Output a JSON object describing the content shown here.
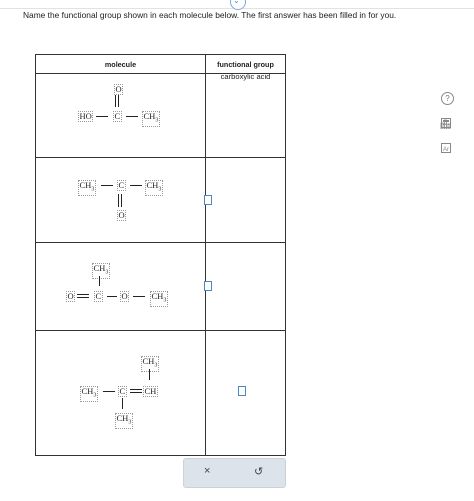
{
  "instructions": "Name the functional group shown in each molecule below. The first answer has been filled in for you.",
  "table": {
    "headers": {
      "molecule": "molecule",
      "functional_group": "functional group"
    },
    "rows": [
      {
        "answer": "carboxylic acid"
      },
      {
        "answer": ""
      },
      {
        "answer": ""
      },
      {
        "answer": ""
      }
    ]
  },
  "molecule1": {
    "o_top": "O",
    "ho": "HO",
    "c": "C",
    "ch3": "CH",
    "sub": "3"
  },
  "molecule2": {
    "ch3_left": "CH",
    "sub_left": "3",
    "c": "C",
    "ch3_right": "CH",
    "sub_right": "3",
    "o_bottom": "O"
  },
  "molecule3": {
    "ch3_top": "CH",
    "sub_top": "3",
    "o_left": "O",
    "c": "C",
    "o_mid": "O",
    "ch3_right": "CH",
    "sub_right": "3"
  },
  "molecule4": {
    "ch3_top": "CH",
    "sub_top": "3",
    "ch3_left": "CH",
    "sub_left": "3",
    "c": "C",
    "ch": "CH",
    "ch3_bottom": "CH",
    "sub_bottom": "3"
  },
  "actions": {
    "clear_icon": "×",
    "undo_icon": "↺"
  },
  "sidebar_icons": [
    "help-icon",
    "calculator-icon",
    "bar-chart-icon",
    "periodic-table-icon"
  ],
  "help_label": "?",
  "colors": {
    "accent": "#4a86c8",
    "action_bar": "#dde3ea"
  }
}
